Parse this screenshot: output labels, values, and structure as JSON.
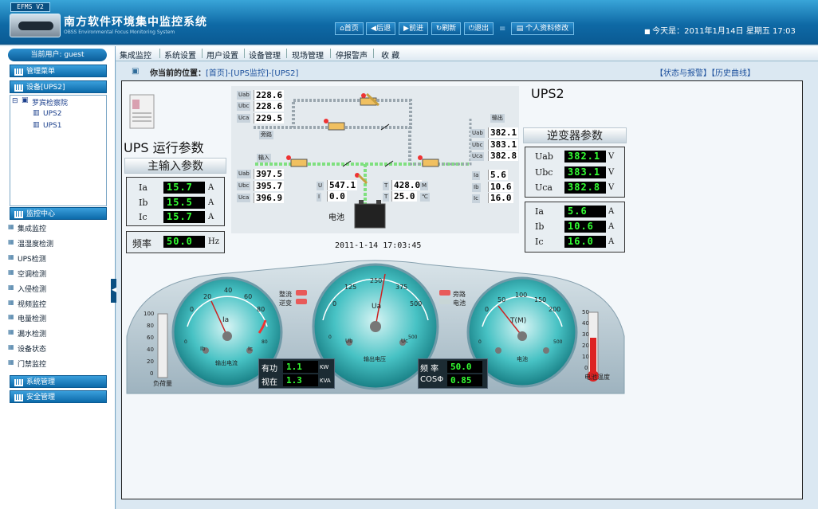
{
  "header": {
    "version_badge": "EFMS V2",
    "title": "南方软件环境集中监控系统",
    "subtitle": "OBSS Environmental Focus Monitoring System",
    "nav": [
      {
        "icon": "home-icon",
        "label": "首页"
      },
      {
        "icon": "back-icon",
        "label": "后退"
      },
      {
        "icon": "forward-icon",
        "label": "前进"
      },
      {
        "icon": "refresh-icon",
        "label": "刷新"
      },
      {
        "icon": "power-icon",
        "label": "退出"
      }
    ],
    "profile_button": "个人资料修改",
    "date_text": "今天是：2011年1月14日 星期五 17:03"
  },
  "menu": [
    "集成监控",
    "系统设置",
    "用户设置",
    "设备管理",
    "现场管理",
    "停报警声",
    "收 藏"
  ],
  "sidebar": {
    "current_user": "当前用户: guest",
    "management_menu": "管理菜单",
    "device_section": "设备[UPS2]",
    "tree_root": "罗宾检察院",
    "tree_children": [
      "UPS2",
      "UPS1"
    ],
    "monitor_section": "监控中心",
    "monitor_items": [
      "集成监控",
      "温湿度检测",
      "UPS检测",
      "空调检测",
      "入侵检测",
      "视频监控",
      "电量检测",
      "漏水检测",
      "设备状态",
      "门禁监控"
    ],
    "system_section": "系统管理",
    "security_section": "安全管理"
  },
  "location": {
    "label": "你当前的位置：",
    "path": "[首页]-[UPS监控]-[UPS2]",
    "links": "【状态与报警】【历史曲线】"
  },
  "ups": {
    "device_name": "UPS2",
    "run_params_title": "UPS 运行参数",
    "main_input_title": "主输入参数",
    "main_input": [
      {
        "label": "Ia",
        "value": "15.7",
        "unit": "A"
      },
      {
        "label": "Ib",
        "value": "15.5",
        "unit": "A"
      },
      {
        "label": "Ic",
        "value": "15.7",
        "unit": "A"
      }
    ],
    "freq": {
      "label": "频率",
      "value": "50.0",
      "unit": "Hz"
    },
    "inverter_title": "逆变器参数",
    "inverter_voltage": [
      {
        "label": "Uab",
        "value": "382.1",
        "unit": "V"
      },
      {
        "label": "Ubc",
        "value": "383.1",
        "unit": "V"
      },
      {
        "label": "Uca",
        "value": "382.8",
        "unit": "V"
      }
    ],
    "inverter_current": [
      {
        "label": "Ia",
        "value": "5.6",
        "unit": "A"
      },
      {
        "label": "Ib",
        "value": "10.6",
        "unit": "A"
      },
      {
        "label": "Ic",
        "value": "16.0",
        "unit": "A"
      }
    ]
  },
  "diagram": {
    "bypass_label": "旁路",
    "input_label": "输入",
    "output_label": "输出",
    "battery_label": "电池",
    "bypass_voltages": [
      {
        "label": "Uab",
        "value": "228.6"
      },
      {
        "label": "Ubc",
        "value": "228.6"
      },
      {
        "label": "Uca",
        "value": "229.5"
      }
    ],
    "input_voltages": [
      {
        "label": "Uab",
        "value": "397.5"
      },
      {
        "label": "Ubc",
        "value": "395.7"
      },
      {
        "label": "Uca",
        "value": "396.9"
      }
    ],
    "output_voltages": [
      {
        "label": "Uab",
        "value": "382.1"
      },
      {
        "label": "Ubc",
        "value": "383.1"
      },
      {
        "label": "Uca",
        "value": "382.8"
      }
    ],
    "output_currents": [
      {
        "label": "Ia",
        "value": "5.6"
      },
      {
        "label": "Ib",
        "value": "10.6"
      },
      {
        "label": "Ic",
        "value": "16.0"
      }
    ],
    "dc": [
      {
        "label": "U",
        "value": "547.1"
      },
      {
        "label": "I",
        "value": "0.0"
      }
    ],
    "battery": [
      {
        "label": "T",
        "value": "428.0",
        "unit": "M"
      },
      {
        "label": "T",
        "value": "25.0",
        "unit": "℃"
      }
    ],
    "timestamp": "2011-1-14 17:03:45"
  },
  "dashboard": {
    "indicators": [
      {
        "label": "整流",
        "color": "#e85a5a"
      },
      {
        "label": "逆变",
        "color": "#e85a5a"
      },
      {
        "label": "旁路",
        "color": "#e85a5a"
      },
      {
        "label": "电池",
        "color": "#c8d6d6"
      }
    ],
    "load_label": "负荷量",
    "load_ticks": [
      "100",
      "80",
      "60",
      "40",
      "20",
      "0"
    ],
    "battery_temp_label": "电池温度",
    "battery_temp_ticks": [
      "50",
      "40",
      "30",
      "20",
      "10",
      "0"
    ],
    "gauge_current": {
      "name": "Ia",
      "sub_left": "Ib",
      "sub_right": "Ic",
      "caption": "输出电流",
      "ticks": [
        "0",
        "20",
        "40",
        "60",
        "80"
      ],
      "sub_ticks": [
        "0",
        "80"
      ]
    },
    "gauge_voltage": {
      "name": "Ua",
      "sub_left": "Ub",
      "sub_right": "Uc",
      "caption": "输出电压",
      "ticks": [
        "0",
        "125",
        "250",
        "375",
        "500"
      ],
      "sub_ticks": [
        "0",
        "500"
      ]
    },
    "gauge_battery": {
      "name": "T(M)",
      "sub_left": "",
      "sub_right": "",
      "caption": "电池",
      "ticks": [
        "0",
        "50",
        "100",
        "150",
        "200"
      ],
      "sub_ticks": [
        "0",
        "500"
      ]
    },
    "active_power": {
      "label": "有功",
      "value": "1.1",
      "unit": "KW"
    },
    "apparent_power": {
      "label": "视在",
      "value": "1.3",
      "unit": "KVA"
    },
    "frequency": {
      "label": "频 率",
      "value": "50.0"
    },
    "power_factor": {
      "label": "COSΦ",
      "value": "0.85"
    }
  }
}
